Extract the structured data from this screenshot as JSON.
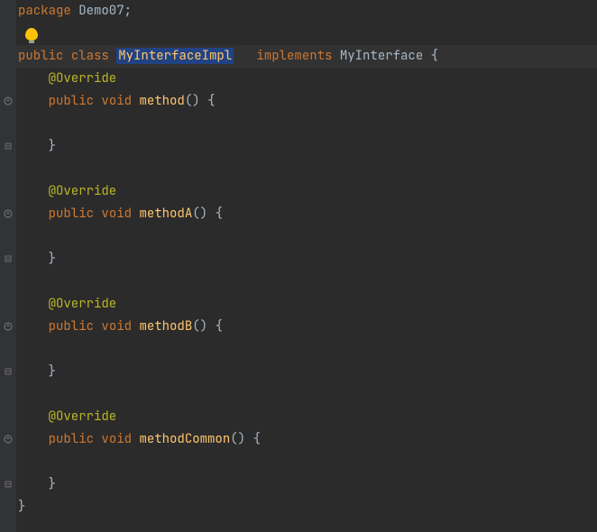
{
  "code": {
    "package_kw": "package",
    "package_name": " Demo07;",
    "public_kw": "public",
    "class_kw": "class",
    "class_name": "MyInterfaceImpl",
    "implements_kw": "implements",
    "interface_name": "MyInterface",
    "open_brace": " {",
    "override": "@Override",
    "void_kw": "void",
    "method1": "method",
    "method2": "methodA",
    "method3": "methodB",
    "method4": "methodCommon",
    "empty_parens_brace": "() {",
    "close_brace": "}",
    "indent1": "    ",
    "indent0": "",
    "space": " ",
    "space3": "   "
  }
}
